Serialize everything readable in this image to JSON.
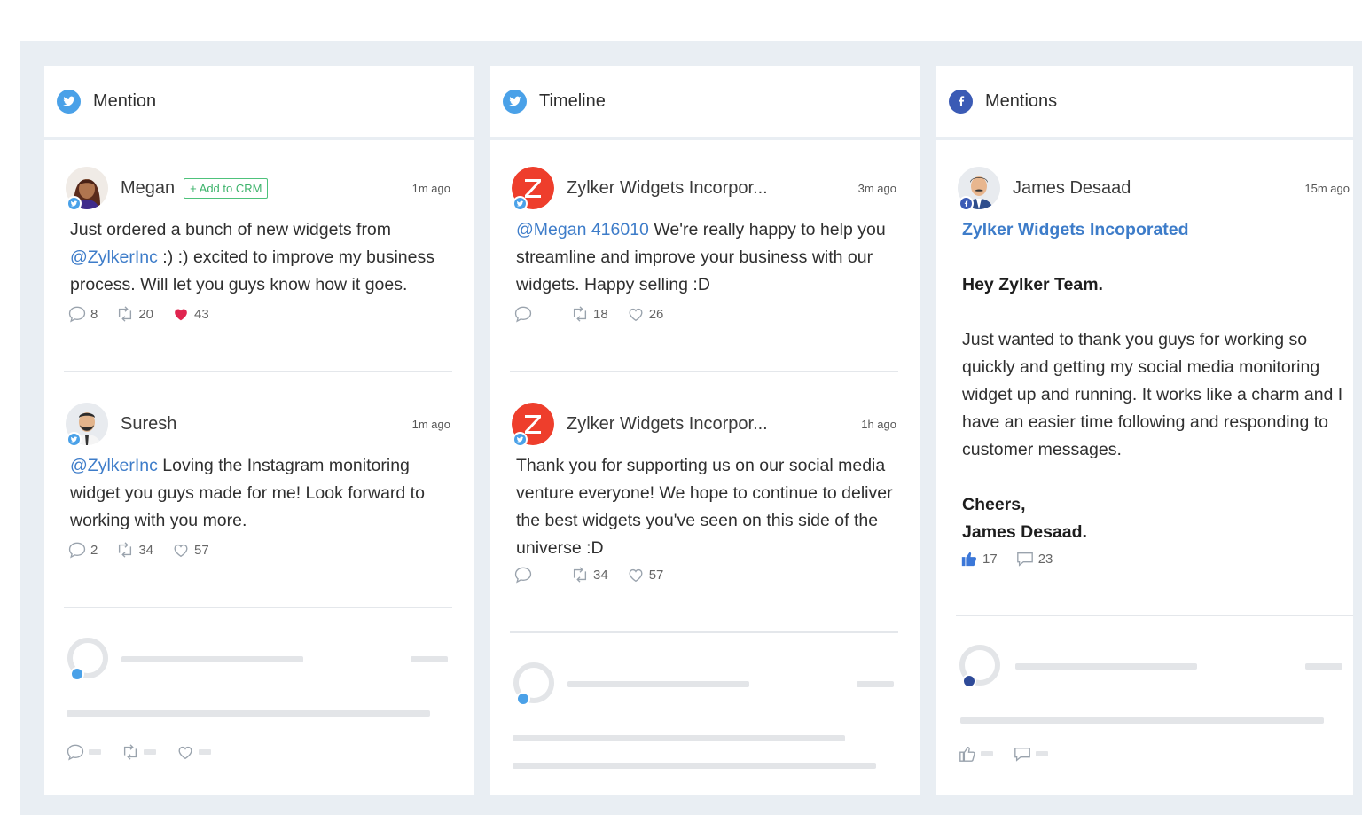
{
  "colors": {
    "twitter": "#4aa1e8",
    "facebook": "#3b5bb5",
    "zylker": "#ee3e2c",
    "mention": "#3d7cc9",
    "heart": "#e0254f",
    "like": "#3b77d8",
    "crm_green": "#3db36b"
  },
  "columns": [
    {
      "title": "Mention",
      "network": "twitter-icon",
      "posts": [
        {
          "author": "Megan",
          "crm_label": "+ Add to CRM",
          "time": "1m ago",
          "text_before": "Just ordered a bunch of new widgets from ",
          "mention": "@ZylkerInc",
          "text_after": " :) :) excited to improve my business process. Will let you guys know how it goes.",
          "replies": "8",
          "retweets": "20",
          "likes": "43"
        },
        {
          "author": "Suresh",
          "time": "1m ago",
          "mention": "@ZylkerInc",
          "text_after": " Loving the Instagram monitoring widget you guys made for me! Look forward to working with you more.",
          "replies": "2",
          "retweets": "34",
          "likes": "57"
        }
      ]
    },
    {
      "title": "Timeline",
      "network": "twitter-icon",
      "posts": [
        {
          "author": "Zylker Widgets Incorpor...",
          "time": "3m ago",
          "mention": "@Megan 416010",
          "text_after": " We're really happy to help you streamline and improve your business with our widgets. Happy selling :D",
          "retweets": "18",
          "likes": "26"
        },
        {
          "author": "Zylker Widgets Incorpor...",
          "time": "1h ago",
          "text_after": "Thank you for supporting us on our social media venture everyone! We hope to continue to deliver the best widgets you've seen on this side of the universe :D",
          "retweets": "34",
          "likes": "57"
        }
      ]
    },
    {
      "title": "Mentions",
      "network": "facebook-icon",
      "posts": [
        {
          "author": "James Desaad",
          "time": "15m ago",
          "page_name": "Zylker Widgets Incoporated",
          "greeting": "Hey Zylker Team.",
          "body": "Just wanted to thank you guys for working so quickly and getting my social media monitoring widget up and running. It works like a charm and I have an easier time following and responding to customer messages.",
          "signoff": "Cheers,",
          "signature": "James Desaad.",
          "likes": "17",
          "comments": "23"
        }
      ]
    }
  ]
}
